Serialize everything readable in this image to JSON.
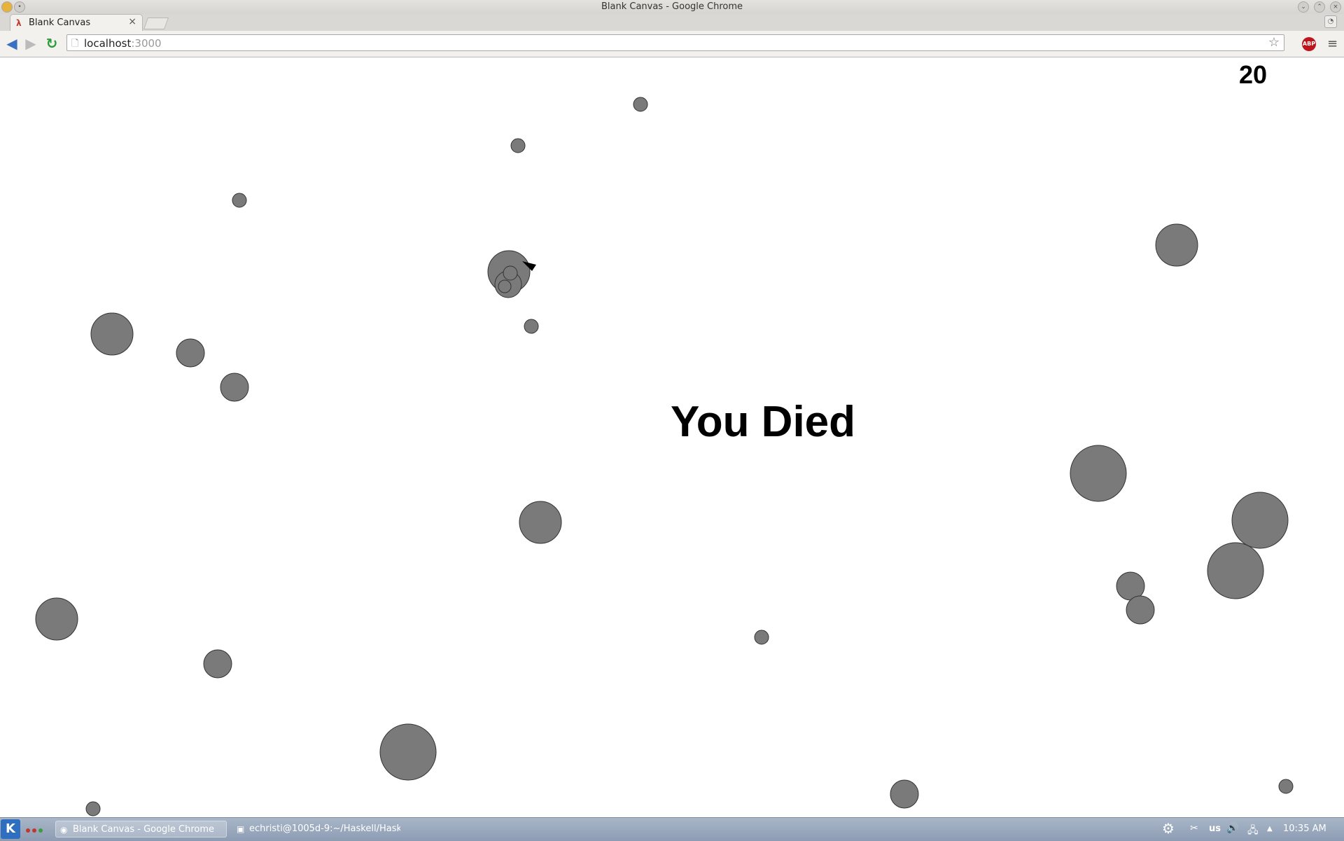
{
  "window": {
    "title": "Blank Canvas - Google Chrome"
  },
  "tabs": [
    {
      "label": "Blank Canvas",
      "close": "×"
    }
  ],
  "toolbar": {
    "url_host": "localhost",
    "url_port": ":3000"
  },
  "game": {
    "score": "20",
    "message": "You Died",
    "circle_color": "#7a7a7a",
    "circle_stroke": "#333333"
  },
  "taskbar": {
    "tasks": [
      {
        "label": "Blank Canvas - Google Chrome"
      },
      {
        "label": "echristi@1005d-9:~/Haskell/Hask"
      }
    ],
    "keyboard_layout": "us",
    "clock": "10:35 AM"
  }
}
